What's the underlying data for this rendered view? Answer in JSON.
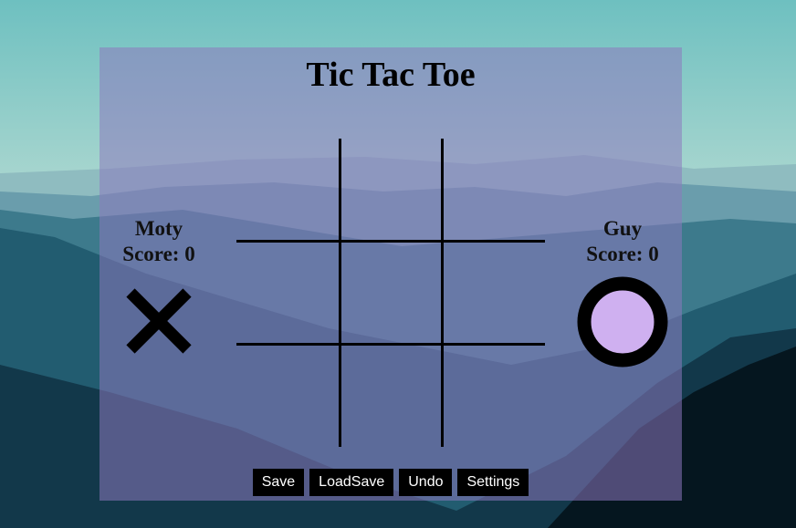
{
  "title": "Tic Tac Toe",
  "players": [
    {
      "name": "Moty",
      "score_label": "Score: 0",
      "mark": "X"
    },
    {
      "name": "Guy",
      "score_label": "Score: 0",
      "mark": "O"
    }
  ],
  "board": [
    "",
    "",
    "",
    "",
    "",
    "",
    "",
    "",
    ""
  ],
  "buttons": {
    "save": "Save",
    "loadsave": "LoadSave",
    "undo": "Undo",
    "settings": "Settings"
  },
  "colors": {
    "o_fill": "#cfb0f0",
    "panel": "#8c78be",
    "button_bg": "#000000"
  }
}
